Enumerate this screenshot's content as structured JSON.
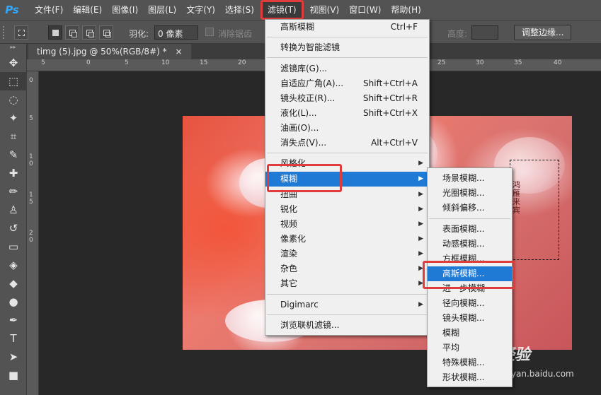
{
  "app": {
    "logo": "Ps"
  },
  "menubar": {
    "items": [
      {
        "label": "文件(F)"
      },
      {
        "label": "编辑(E)"
      },
      {
        "label": "图像(I)"
      },
      {
        "label": "图层(L)"
      },
      {
        "label": "文字(Y)"
      },
      {
        "label": "选择(S)"
      },
      {
        "label": "滤镜(T)",
        "active": true
      },
      {
        "label": "视图(V)"
      },
      {
        "label": "窗口(W)"
      },
      {
        "label": "帮助(H)"
      }
    ]
  },
  "options": {
    "feather_label": "羽化:",
    "feather_value": "0 像素",
    "antialias_label": "消除锯齿",
    "height_label": "高度:",
    "refine_edge_button": "调整边缘..."
  },
  "document": {
    "tab_title": "timg (5).jpg @ 50%(RGB/8#) *",
    "close_glyph": "×"
  },
  "ruler": {
    "top_labels": [
      "5",
      "0",
      "5",
      "10",
      "15",
      "20",
      "25",
      "30",
      "35",
      "40"
    ],
    "left_labels": [
      "0",
      "5",
      "1\n0",
      "1\n5",
      "2\n0"
    ]
  },
  "canvas": {
    "selection_text": "鸿雁来宾",
    "watermark": "Bai 经验",
    "watermark_url": "jingyan.baidu.com"
  },
  "filter_menu": {
    "items": [
      {
        "label": "高斯模糊",
        "shortcut": "Ctrl+F"
      },
      {
        "label": "转换为智能滤镜",
        "shortcut": ""
      },
      {
        "label": "滤镜库(G)...",
        "shortcut": ""
      },
      {
        "label": "自适应广角(A)...",
        "shortcut": "Shift+Ctrl+A"
      },
      {
        "label": "镜头校正(R)...",
        "shortcut": "Shift+Ctrl+R"
      },
      {
        "label": "液化(L)...",
        "shortcut": "Shift+Ctrl+X"
      },
      {
        "label": "油画(O)...",
        "shortcut": ""
      },
      {
        "label": "消失点(V)...",
        "shortcut": "Alt+Ctrl+V"
      },
      {
        "label": "风格化",
        "submenu": true
      },
      {
        "label": "模糊",
        "submenu": true,
        "highlighted": true
      },
      {
        "label": "扭曲",
        "submenu": true
      },
      {
        "label": "锐化",
        "submenu": true
      },
      {
        "label": "视频",
        "submenu": true
      },
      {
        "label": "像素化",
        "submenu": true
      },
      {
        "label": "渲染",
        "submenu": true
      },
      {
        "label": "杂色",
        "submenu": true
      },
      {
        "label": "其它",
        "submenu": true
      },
      {
        "label": "Digimarc",
        "submenu": true
      },
      {
        "label": "浏览联机滤镜...",
        "shortcut": ""
      }
    ],
    "arrow_glyph": "▶"
  },
  "blur_submenu": {
    "items": [
      {
        "label": "场景模糊..."
      },
      {
        "label": "光圈模糊..."
      },
      {
        "label": "倾斜偏移..."
      },
      {
        "label": "表面模糊..."
      },
      {
        "label": "动感模糊..."
      },
      {
        "label": "方框模糊..."
      },
      {
        "label": "高斯模糊...",
        "highlighted": true
      },
      {
        "label": "进一步模糊"
      },
      {
        "label": "径向模糊..."
      },
      {
        "label": "镜头模糊..."
      },
      {
        "label": "模糊"
      },
      {
        "label": "平均"
      },
      {
        "label": "特殊模糊..."
      },
      {
        "label": "形状模糊..."
      }
    ]
  },
  "colors": {
    "highlight": "#1f7ad6",
    "annotation_red": "#e03c3c",
    "ps_blue": "#31a8ff"
  },
  "toolbox": {
    "tools": [
      "move-icon",
      "marquee-icon",
      "lasso-icon",
      "magic-wand-icon",
      "crop-icon",
      "eyedropper-icon",
      "healing-icon",
      "brush-icon",
      "stamp-icon",
      "history-brush-icon",
      "eraser-icon",
      "bucket-icon",
      "blur-tool-icon",
      "dodge-icon",
      "pen-icon",
      "type-icon",
      "path-select-icon",
      "rectangle-icon"
    ],
    "glyphs": [
      "✥",
      "⬚",
      "◌",
      "✦",
      "⌗",
      "✎",
      "✚",
      "✏",
      "♙",
      "↺",
      "▭",
      "◈",
      "◆",
      "●",
      "✒",
      "T",
      "➤",
      "■"
    ]
  }
}
